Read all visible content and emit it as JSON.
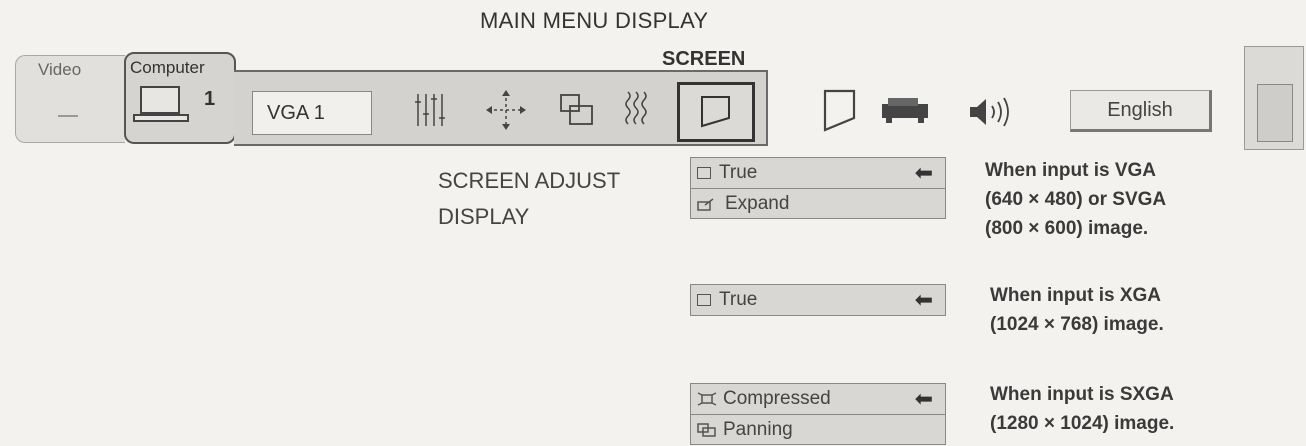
{
  "header": {
    "title": "MAIN MENU DISPLAY",
    "screen_label": "SCREEN"
  },
  "menubar": {
    "video_label": "Video",
    "computer_label": "Computer",
    "computer_number": "1",
    "input_field_value": "VGA 1",
    "language_label": "English",
    "icons": [
      "computer-icon",
      "image-adjust-icon",
      "position-icon",
      "pc-adjust-icon",
      "image-level-icon",
      "screen-icon",
      "keystone-icon",
      "projector-icon",
      "sound-icon"
    ]
  },
  "adjust": {
    "label_line1": "SCREEN ADJUST",
    "label_line2": "DISPLAY"
  },
  "menus": [
    {
      "items": [
        {
          "label": "True",
          "selected": true
        },
        {
          "label": "Expand",
          "selected": false
        }
      ],
      "note_lines": [
        "When input  is VGA",
        "(640 × 480) or SVGA",
        "(800 × 600) image."
      ]
    },
    {
      "items": [
        {
          "label": "True",
          "selected": true
        }
      ],
      "note_lines": [
        "When input  is XGA",
        "(1024 × 768) image."
      ]
    },
    {
      "items": [
        {
          "label": "Compressed",
          "selected": true
        },
        {
          "label": "Panning",
          "selected": false
        }
      ],
      "note_lines": [
        "When input  is SXGA",
        "(1280 × 1024) image."
      ]
    }
  ],
  "arrow_glyph": "⬅"
}
